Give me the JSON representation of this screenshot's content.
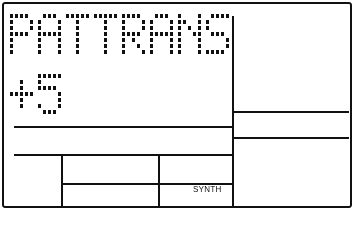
{
  "display": {
    "patch_name": "PATTRANS",
    "value": "+5",
    "mode_label": "SYNTH"
  }
}
